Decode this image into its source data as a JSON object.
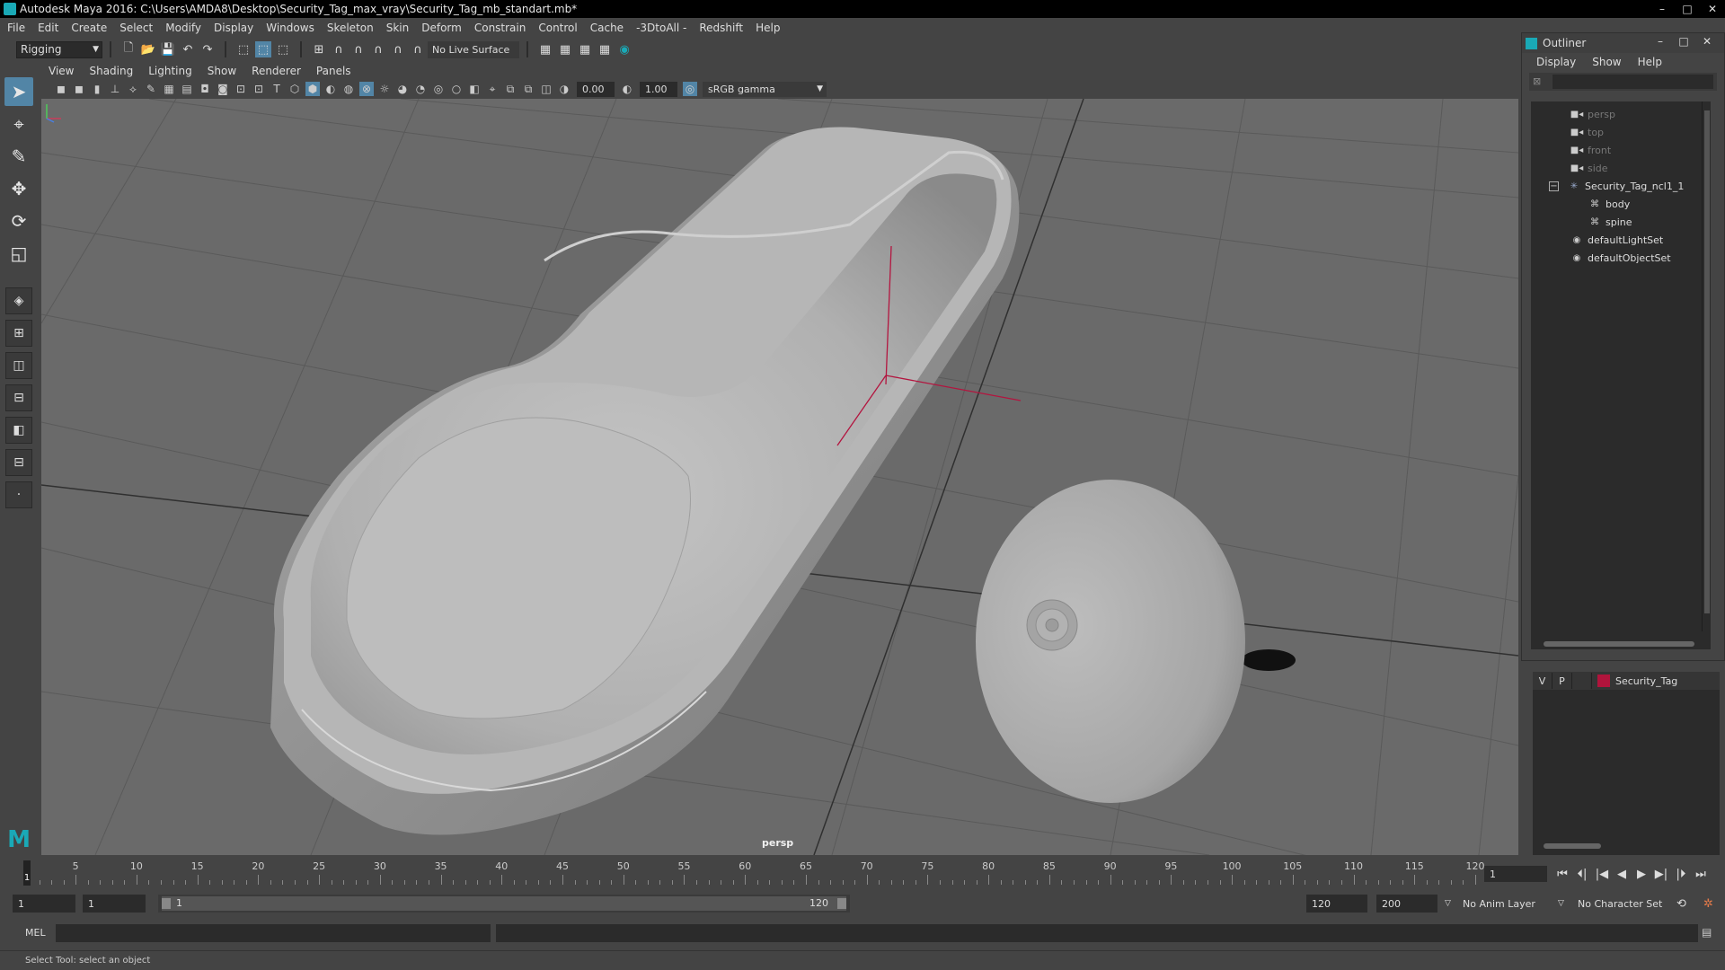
{
  "window": {
    "title": "Autodesk Maya 2016: C:\\Users\\AMDA8\\Desktop\\Security_Tag_max_vray\\Security_Tag_mb_standart.mb*",
    "controls": [
      "–",
      "□",
      "✕"
    ]
  },
  "menubar": [
    "File",
    "Edit",
    "Create",
    "Select",
    "Modify",
    "Display",
    "Windows",
    "Skeleton",
    "Skin",
    "Deform",
    "Constrain",
    "Control",
    "Cache",
    "-3DtoAll -",
    "Redshift",
    "Help"
  ],
  "statusline": {
    "mode": "Rigging",
    "live_surface": "No Live Surface"
  },
  "panel": {
    "menu": [
      "View",
      "Shading",
      "Lighting",
      "Show",
      "Renderer",
      "Panels"
    ],
    "exposure": "0.00",
    "gamma": "1.00",
    "color_space": "sRGB gamma",
    "camera": "persp"
  },
  "outliner": {
    "title": "Outliner",
    "menu": [
      "Display",
      "Show",
      "Help"
    ],
    "items": [
      {
        "label": "persp",
        "icon": "camera-icon",
        "dim": true,
        "indent": 0
      },
      {
        "label": "top",
        "icon": "camera-icon",
        "dim": true,
        "indent": 0
      },
      {
        "label": "front",
        "icon": "camera-icon",
        "dim": true,
        "indent": 0
      },
      {
        "label": "side",
        "icon": "camera-icon",
        "dim": true,
        "indent": 0
      },
      {
        "label": "Security_Tag_ncl1_1",
        "icon": "group-icon",
        "dim": false,
        "indent": 0
      },
      {
        "label": "body",
        "icon": "mesh-icon",
        "dim": false,
        "indent": 1
      },
      {
        "label": "spine",
        "icon": "mesh-icon",
        "dim": false,
        "indent": 1
      },
      {
        "label": "defaultLightSet",
        "icon": "set-icon",
        "dim": false,
        "indent": 0
      },
      {
        "label": "defaultObjectSet",
        "icon": "set-icon",
        "dim": false,
        "indent": 0
      }
    ]
  },
  "layers": [
    {
      "v": "V",
      "p": "P",
      "name": "Security_Tag",
      "color": "#b0143c"
    }
  ],
  "timeline": {
    "ticks": [
      "1",
      "5",
      "10",
      "15",
      "20",
      "25",
      "30",
      "35",
      "40",
      "45",
      "50",
      "55",
      "60",
      "65",
      "70",
      "75",
      "80",
      "85",
      "90",
      "95",
      "100",
      "105",
      "110",
      "115",
      "120"
    ],
    "current_frame": "1",
    "current_field": "1"
  },
  "range": {
    "start": "1",
    "playback_start": "1",
    "slider_start": "1",
    "slider_end": "120",
    "playback_end": "120",
    "end": "200",
    "anim_layer": "No Anim Layer",
    "character_set": "No Character Set"
  },
  "commandline": {
    "label": "MEL"
  },
  "helpline": "Select Tool: select an object",
  "colors": {
    "accent": "#5285a6",
    "maya_teal": "#1aa9b6",
    "layer_red": "#b0143c"
  }
}
